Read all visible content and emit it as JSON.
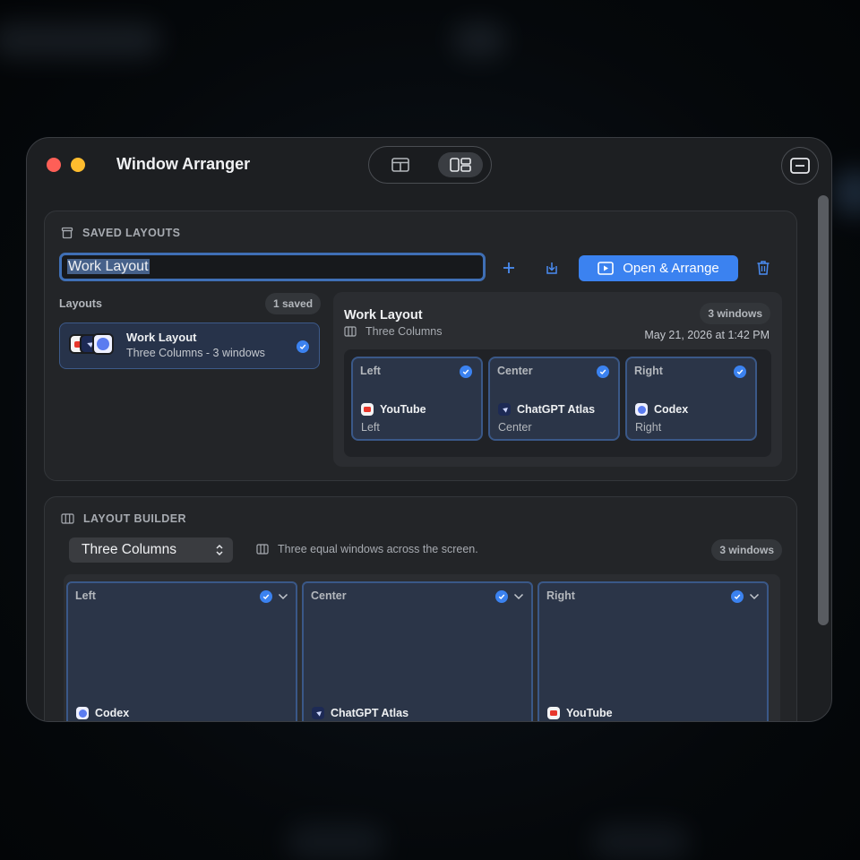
{
  "window": {
    "title": "Window Arranger"
  },
  "saved": {
    "header": "SAVED LAYOUTS",
    "name_value": "Work Layout",
    "open_label": "Open & Arrange",
    "layouts_label": "Layouts",
    "saved_count": "1 saved",
    "items": [
      {
        "title": "Work Layout",
        "subtitle": "Three Columns - 3 windows"
      }
    ],
    "preview": {
      "title": "Work Layout",
      "subtitle": "Three Columns",
      "windows_count": "3 windows",
      "date": "May 21, 2026 at 1:42 PM",
      "cards": [
        {
          "label": "Left",
          "app": "YouTube",
          "position": "Left"
        },
        {
          "label": "Center",
          "app": "ChatGPT Atlas",
          "position": "Center"
        },
        {
          "label": "Right",
          "app": "Codex",
          "position": "Right"
        }
      ]
    }
  },
  "builder": {
    "header": "LAYOUT BUILDER",
    "selected_layout": "Three Columns",
    "description": "Three equal windows across the screen.",
    "windows_count": "3 windows",
    "columns": [
      {
        "label": "Left",
        "app": "Codex"
      },
      {
        "label": "Center",
        "app": "ChatGPT Atlas"
      },
      {
        "label": "Right",
        "app": "YouTube"
      }
    ]
  },
  "colors": {
    "accent": "#3b82f0",
    "youtube": "#e8372c",
    "codex": "#5b7cf0",
    "atlas": "#1d2a55"
  },
  "icons": {
    "saved_header": "archive-box-icon",
    "builder_header": "columns-icon",
    "add": "plus-icon",
    "save": "download-tray-icon",
    "open": "play-screen-icon",
    "delete": "trash-icon"
  }
}
